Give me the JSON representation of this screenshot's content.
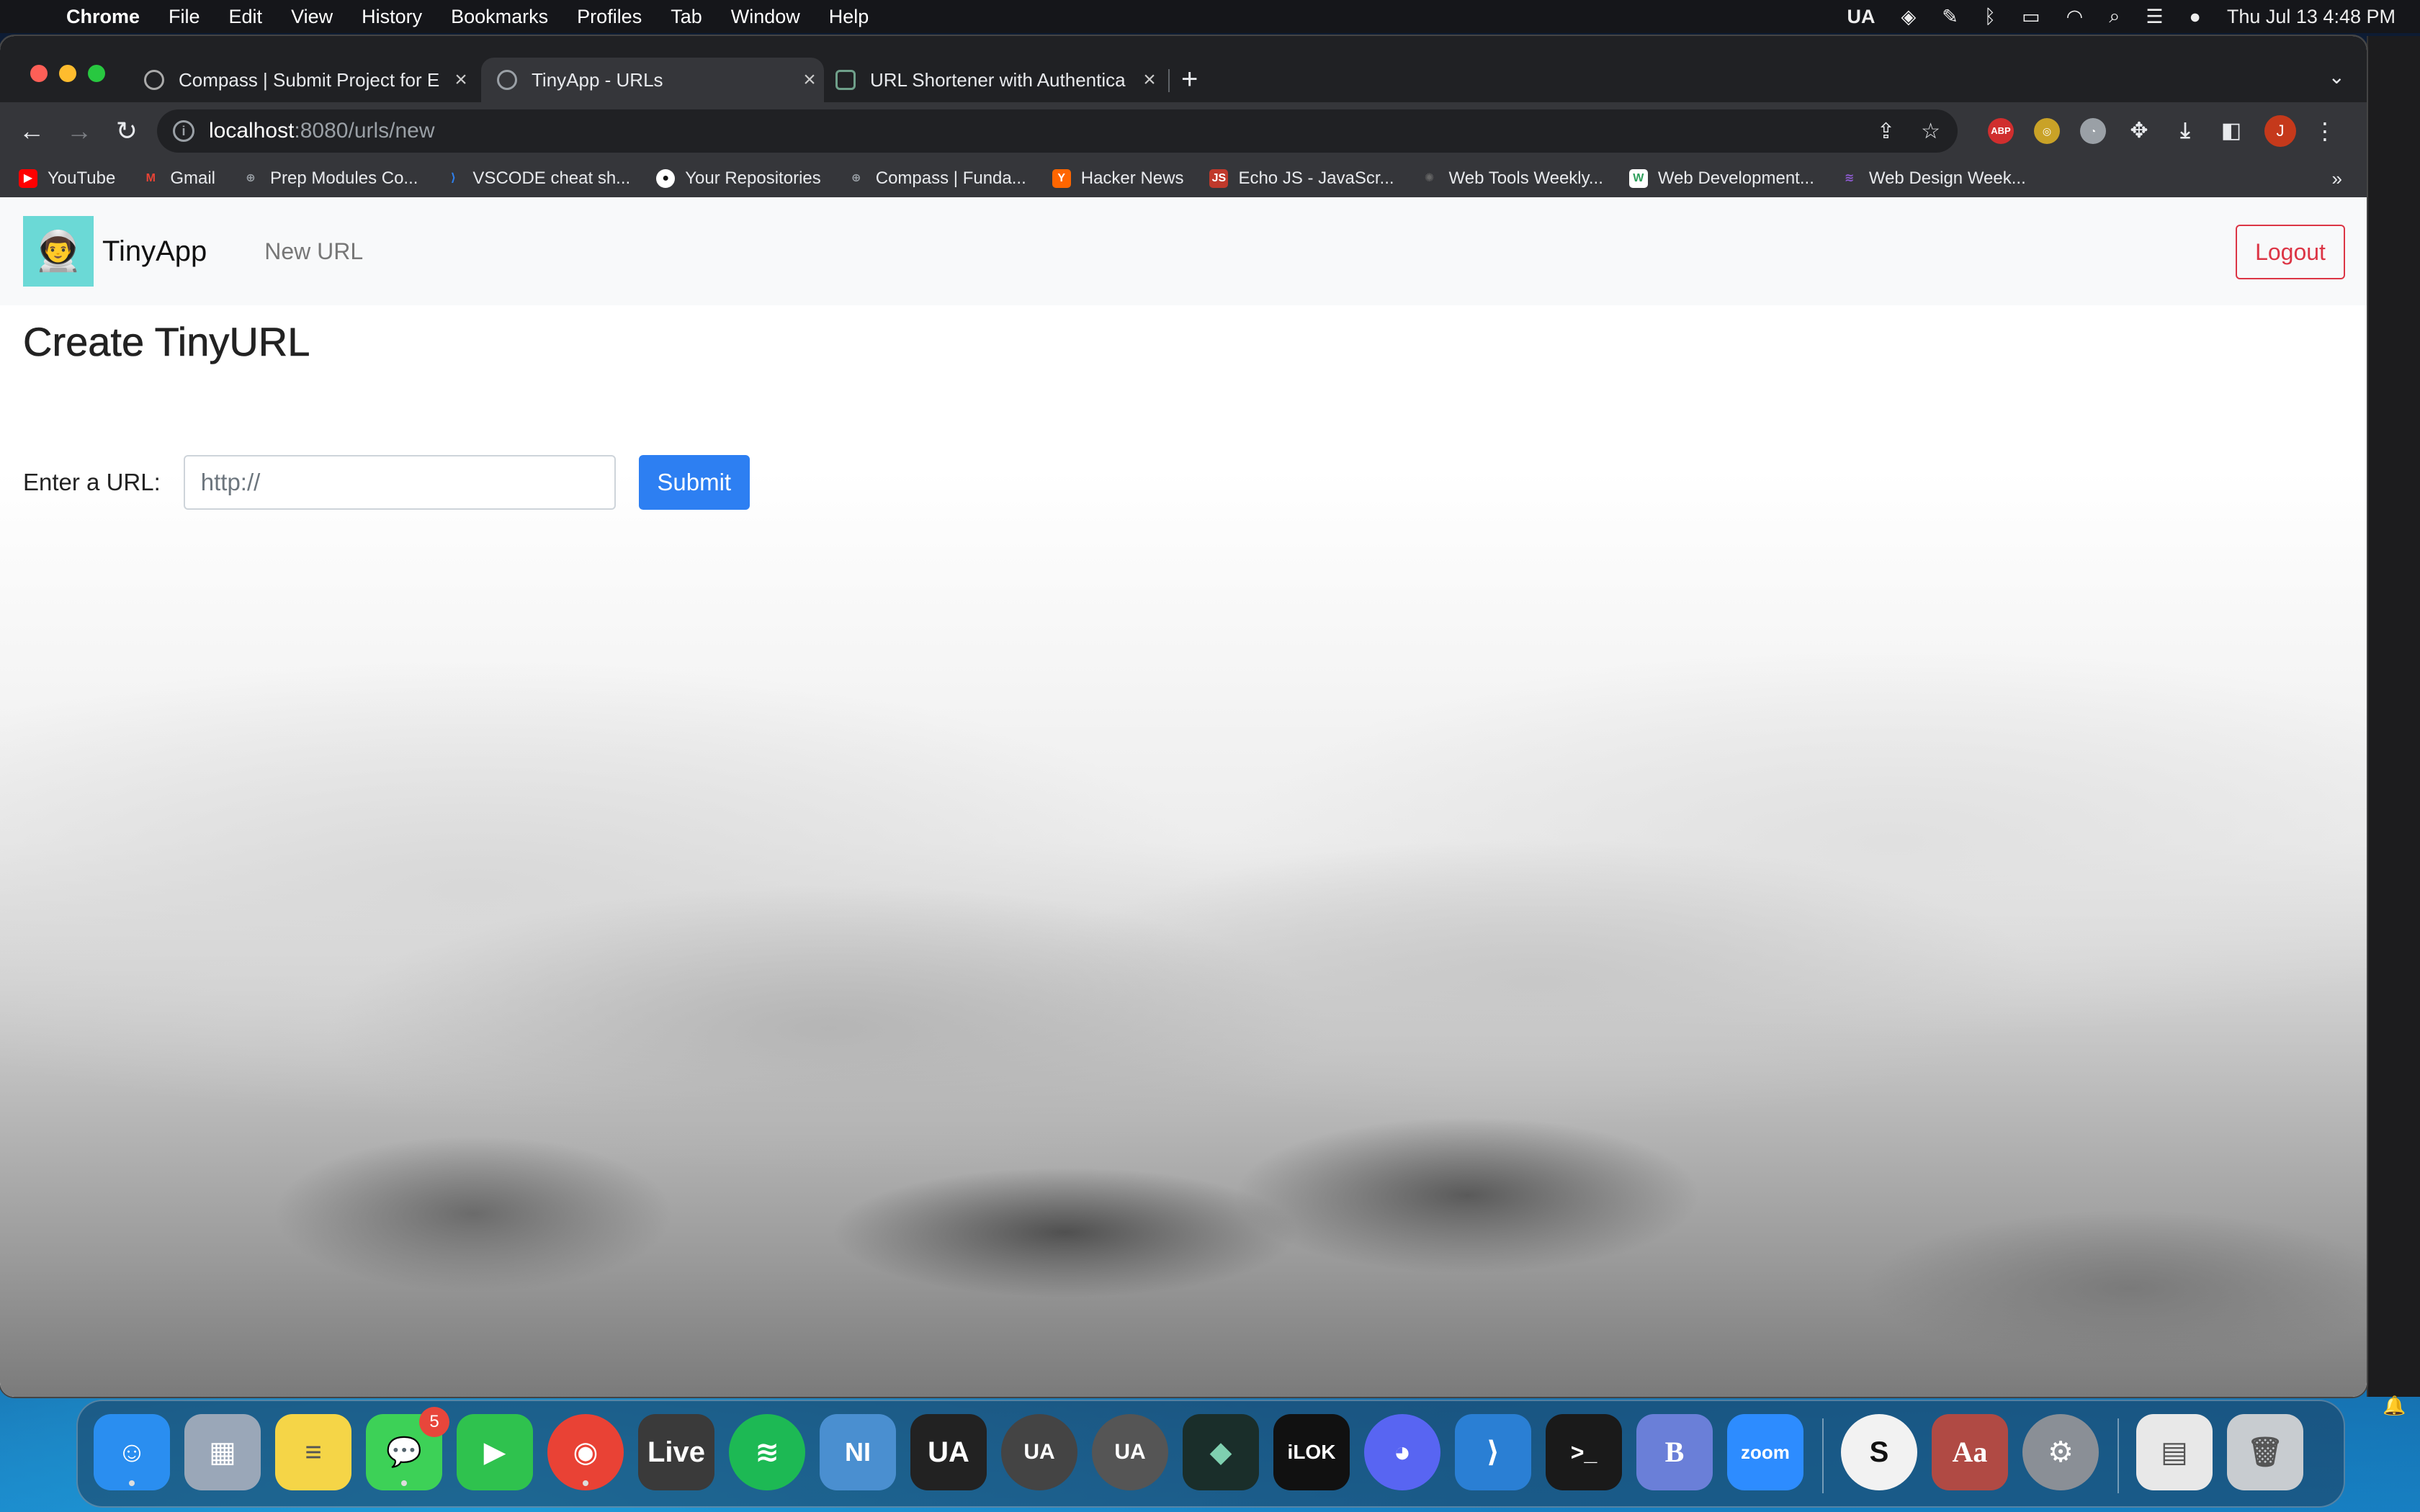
{
  "menubar": {
    "app_name": "Chrome",
    "items": [
      "File",
      "Edit",
      "View",
      "History",
      "Bookmarks",
      "Profiles",
      "Tab",
      "Window",
      "Help"
    ],
    "status": {
      "ua_label": "UA",
      "datetime": "Thu Jul 13  4:48 PM"
    }
  },
  "browser": {
    "tabs": [
      {
        "title": "Compass | Submit Project for E",
        "active": false,
        "icon": "compass-icon"
      },
      {
        "title": "TinyApp - URLs",
        "active": true,
        "icon": "globe-icon"
      },
      {
        "title": "URL Shortener with Authentica",
        "active": false,
        "icon": "chatgpt-icon"
      }
    ],
    "address": {
      "host": "localhost",
      "path": ":8080/urls/new"
    },
    "profile_initial": "J",
    "extensions": {
      "abp_label": "ABP"
    },
    "bookmarks": [
      {
        "label": "YouTube",
        "icon": "youtube-icon",
        "color": "#ff0000"
      },
      {
        "label": "Gmail",
        "icon": "gmail-icon",
        "color": "#ea4335"
      },
      {
        "label": "Prep Modules Co...",
        "icon": "compass-icon",
        "color": "#9aa0a6"
      },
      {
        "label": "VSCODE cheat sh...",
        "icon": "vscode-icon",
        "color": "#2f80ed"
      },
      {
        "label": "Your Repositories",
        "icon": "github-icon",
        "color": "#ffffff"
      },
      {
        "label": "Compass | Funda...",
        "icon": "compass-icon",
        "color": "#9aa0a6"
      },
      {
        "label": "Hacker News",
        "icon": "hackernews-icon",
        "color": "#ff6600"
      },
      {
        "label": "Echo JS - JavaScr...",
        "icon": "echojs-icon",
        "color": "#c0392b"
      },
      {
        "label": "Web Tools Weekly...",
        "icon": "gear-icon",
        "color": "#555555"
      },
      {
        "label": "Web Development...",
        "icon": "w-icon",
        "color": "#2e9e5b"
      },
      {
        "label": "Web Design Week...",
        "icon": "wave-icon",
        "color": "#8e5bd1"
      }
    ]
  },
  "page": {
    "brand": "TinyApp",
    "nav_new_url": "New URL",
    "logout_label": "Logout",
    "title": "Create TinyURL",
    "form": {
      "label": "Enter a URL:",
      "placeholder": "http://",
      "submit_label": "Submit"
    }
  },
  "dock": {
    "messages_badge": "5",
    "apps": [
      {
        "name": "finder",
        "glyph": "☺",
        "color": "#2a8ef0"
      },
      {
        "name": "launchpad",
        "glyph": "▦",
        "color": "#9aa7b8"
      },
      {
        "name": "notes",
        "glyph": "≡",
        "color": "#f5d547"
      },
      {
        "name": "messages",
        "glyph": "💬",
        "color": "#3dd157"
      },
      {
        "name": "facetime",
        "glyph": "▶",
        "color": "#2fc24e"
      },
      {
        "name": "chrome",
        "glyph": "◉",
        "color": "#e94235"
      },
      {
        "name": "ableton-live",
        "glyph": "Live",
        "color": "#3a3a3a"
      },
      {
        "name": "spotify",
        "glyph": "≋",
        "color": "#1db954"
      },
      {
        "name": "native-instruments",
        "glyph": "NI",
        "color": "#4a8fd0"
      },
      {
        "name": "ua-connect",
        "glyph": "UA",
        "color": "#222222"
      },
      {
        "name": "ua-console",
        "glyph": "UA",
        "color": "#444444"
      },
      {
        "name": "ua-meter",
        "glyph": "UA",
        "color": "#555555"
      },
      {
        "name": "ableton-vector",
        "glyph": "◆",
        "color": "#1a2e2a"
      },
      {
        "name": "ilok",
        "glyph": "iLOK",
        "color": "#111111"
      },
      {
        "name": "discord",
        "glyph": "◕",
        "color": "#5865f2"
      },
      {
        "name": "vscode",
        "glyph": "⟩",
        "color": "#2a7fd4"
      },
      {
        "name": "terminal",
        "glyph": ">_",
        "color": "#1a1a1a"
      },
      {
        "name": "bbedit",
        "glyph": "B",
        "color": "#6a7fd8"
      },
      {
        "name": "zoom",
        "glyph": "zoom",
        "color": "#2d8cff"
      },
      {
        "name": "scrivener",
        "glyph": "S",
        "color": "#f2f2f2"
      },
      {
        "name": "dictionary",
        "glyph": "Aa",
        "color": "#b04a44"
      },
      {
        "name": "system-preferences",
        "glyph": "⚙",
        "color": "#8a8f96"
      },
      {
        "name": "downloads-stack",
        "glyph": "▤",
        "color": "#e8e8e8"
      },
      {
        "name": "trash",
        "glyph": "🗑",
        "color": "#c8ccd0"
      }
    ]
  }
}
